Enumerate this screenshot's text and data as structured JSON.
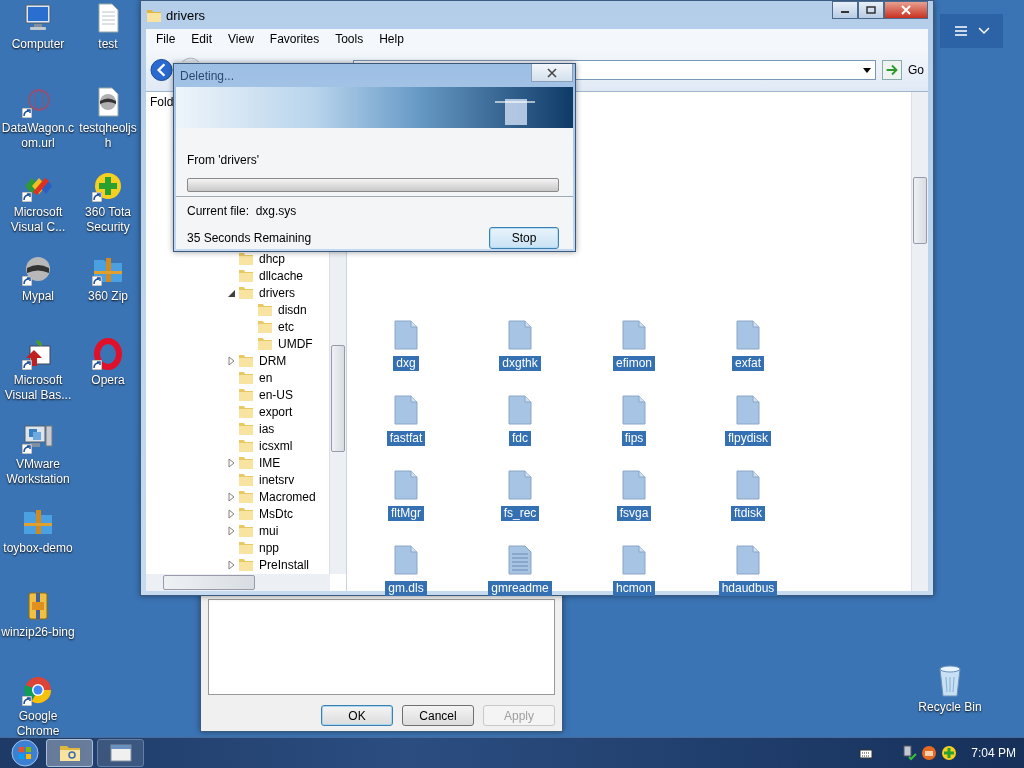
{
  "desktop": {
    "columns": [
      [
        {
          "label": "Computer",
          "kind": "computer",
          "shortcut": false
        },
        {
          "label": "DataWagon.com.url",
          "kind": "web-link",
          "shortcut": true
        },
        {
          "label": "Microsoft Visual C...",
          "kind": "blocks",
          "shortcut": true
        },
        {
          "label": "Mypal",
          "kind": "round-logo",
          "shortcut": true
        },
        {
          "label": "Microsoft Visual Bas...",
          "kind": "vb",
          "shortcut": true
        },
        {
          "label": "VMware Workstation",
          "kind": "vm",
          "shortcut": true
        },
        {
          "label": "toybox-demo",
          "kind": "zip-folder",
          "shortcut": false
        },
        {
          "label": "winzip26-bing",
          "kind": "zip-file",
          "shortcut": false
        },
        {
          "label": "Google Chrome",
          "kind": "chrome",
          "shortcut": true
        }
      ],
      [
        {
          "label": "test",
          "kind": "document",
          "shortcut": false
        },
        {
          "label": "testqheoljsh",
          "kind": "logo-document",
          "shortcut": false
        },
        {
          "label": "360 Tota Security",
          "kind": "plus-circle",
          "shortcut": true
        },
        {
          "label": "360 Zip",
          "kind": "zip-folder",
          "shortcut": true
        },
        {
          "label": "Opera",
          "kind": "opera",
          "shortcut": true
        }
      ]
    ],
    "recycle_bin": "Recycle Bin"
  },
  "explorer": {
    "title": "drivers",
    "menu": [
      "File",
      "Edit",
      "View",
      "Favorites",
      "Tools",
      "Help"
    ],
    "go_button": "Go",
    "folders_header": "Fold",
    "tree": [
      {
        "label": "dhcp",
        "kind": "leaf"
      },
      {
        "label": "dllcache",
        "kind": "leaf"
      },
      {
        "label": "drivers",
        "kind": "branch",
        "expanded": true,
        "children": [
          {
            "label": "disdn",
            "kind": "leaf"
          },
          {
            "label": "etc",
            "kind": "leaf"
          },
          {
            "label": "UMDF",
            "kind": "leaf"
          }
        ]
      },
      {
        "label": "DRM",
        "kind": "branch",
        "expanded": false
      },
      {
        "label": "en",
        "kind": "leaf"
      },
      {
        "label": "en-US",
        "kind": "leaf"
      },
      {
        "label": "export",
        "kind": "leaf"
      },
      {
        "label": "ias",
        "kind": "leaf"
      },
      {
        "label": "icsxml",
        "kind": "leaf"
      },
      {
        "label": "IME",
        "kind": "branch",
        "expanded": false
      },
      {
        "label": "inetsrv",
        "kind": "leaf"
      },
      {
        "label": "Macromed",
        "kind": "branch",
        "expanded": false
      },
      {
        "label": "MsDtc",
        "kind": "branch",
        "expanded": false
      },
      {
        "label": "mui",
        "kind": "branch",
        "expanded": false
      },
      {
        "label": "npp",
        "kind": "leaf"
      },
      {
        "label": "PreInstall",
        "kind": "branch",
        "expanded": false
      }
    ],
    "files": [
      {
        "name": "dxg",
        "kind": "file",
        "selected": true
      },
      {
        "name": "dxgthk",
        "kind": "file",
        "selected": true
      },
      {
        "name": "efimon",
        "kind": "file",
        "selected": true
      },
      {
        "name": "exfat",
        "kind": "file",
        "selected": true
      },
      {
        "name": "fastfat",
        "kind": "file",
        "selected": true
      },
      {
        "name": "fdc",
        "kind": "file",
        "selected": true
      },
      {
        "name": "fips",
        "kind": "file",
        "selected": true
      },
      {
        "name": "flpydisk",
        "kind": "file",
        "selected": true
      },
      {
        "name": "fltMgr",
        "kind": "file",
        "selected": true
      },
      {
        "name": "fs_rec",
        "kind": "file",
        "selected": true
      },
      {
        "name": "fsvga",
        "kind": "file",
        "selected": true
      },
      {
        "name": "ftdisk",
        "kind": "file",
        "selected": true
      },
      {
        "name": "gm.dls",
        "kind": "file",
        "selected": true
      },
      {
        "name": "gmreadme",
        "kind": "text",
        "selected": true
      },
      {
        "name": "hcmon",
        "kind": "file",
        "selected": true
      },
      {
        "name": "hdaudbus",
        "kind": "file",
        "selected": true
      }
    ]
  },
  "progress_dialog": {
    "title": "Deleting...",
    "from": "From 'drivers'",
    "level": 0,
    "current_file": "Current file:  dxg.sys",
    "remaining": "35 Seconds Remaining",
    "stop_button": "Stop"
  },
  "properties_dialog": {
    "buttons": [
      {
        "label": "OK",
        "default": true,
        "disabled": false
      },
      {
        "label": "Cancel",
        "default": false,
        "disabled": false
      },
      {
        "label": "Apply",
        "default": false,
        "disabled": true
      }
    ]
  },
  "taskbar": {
    "buttons": [
      {
        "kind": "explorer",
        "selected": true
      },
      {
        "kind": "window",
        "selected": false
      }
    ],
    "clock": "7:04 PM"
  }
}
